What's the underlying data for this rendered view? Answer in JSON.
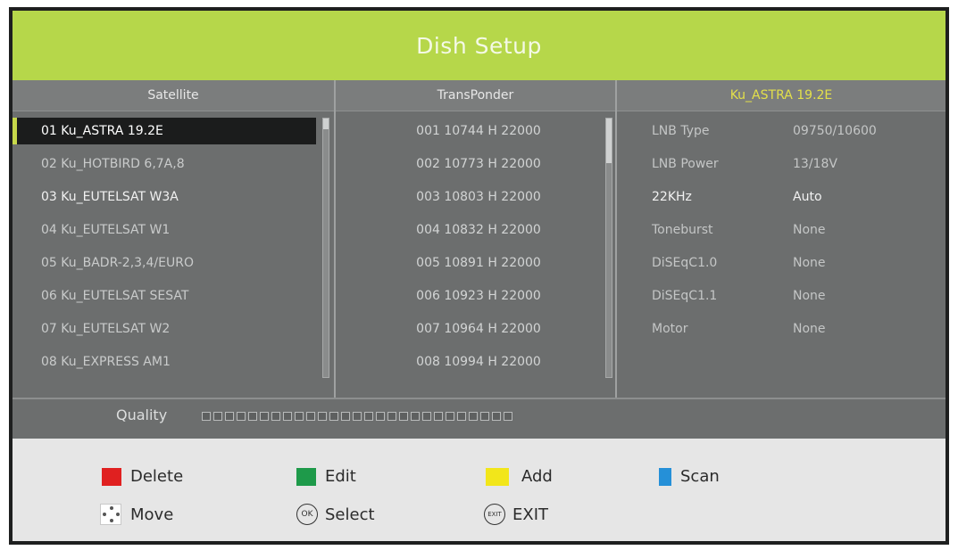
{
  "title": "Dish Setup",
  "columns": {
    "satellite": "Satellite",
    "transponder": "TransPonder",
    "info": "Ku_ASTRA 19.2E"
  },
  "satellites": [
    "01 Ku_ASTRA 19.2E",
    "02 Ku_HOTBIRD 6,7A,8",
    "03 Ku_EUTELSAT W3A",
    "04 Ku_EUTELSAT W1",
    "05 Ku_BADR-2,3,4/EURO",
    "06 Ku_EUTELSAT SESAT",
    "07 Ku_EUTELSAT W2",
    "08 Ku_EXPRESS AM1"
  ],
  "transponders": [
    "001 10744 H 22000",
    "002 10773 H 22000",
    "003 10803 H 22000",
    "004 10832 H 22000",
    "005 10891 H 22000",
    "006 10923 H 22000",
    "007 10964 H 22000",
    "008 10994 H 22000"
  ],
  "settings": [
    {
      "label": "LNB Type",
      "value": "09750/10600"
    },
    {
      "label": "LNB Power",
      "value": "13/18V"
    },
    {
      "label": "22KHz",
      "value": "Auto"
    },
    {
      "label": "Toneburst",
      "value": "None"
    },
    {
      "label": "DiSEqC1.0",
      "value": "None"
    },
    {
      "label": "DiSEqC1.1",
      "value": "None"
    },
    {
      "label": "Motor",
      "value": "None"
    }
  ],
  "quality": {
    "label": "Quality",
    "value": 0
  },
  "footer": {
    "delete": {
      "label": "Delete",
      "color": "#e02020"
    },
    "edit": {
      "label": "Edit",
      "color": "#1e9a4a"
    },
    "add": {
      "label": "Add",
      "color": "#f2e61a"
    },
    "scan": {
      "label": "Scan",
      "color": "#2590d8"
    },
    "move": {
      "label": "Move"
    },
    "select": {
      "label": "Select",
      "icon_text": "OK"
    },
    "exit": {
      "label": "EXIT",
      "icon_text": "EXIT"
    }
  },
  "colors": {
    "title_bar": "#b6d74a",
    "highlight": "#e3e04a"
  }
}
